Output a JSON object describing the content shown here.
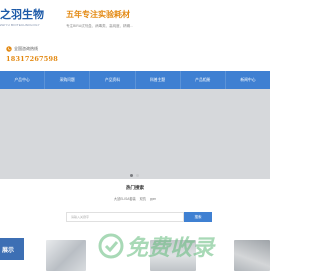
{
  "header": {
    "logo_text": "之羽生物",
    "logo_sub": "ZHIYU BIOTECHNOLOGY",
    "slogan": "五年专注实验耗材",
    "subslogan": "专注BIRA试剂盒、病毒类、高纯度、精确...",
    "hotline_label": "全国咨询热线",
    "hotline_number": "18317267598"
  },
  "nav": {
    "items": [
      "产品中心",
      "采购问题",
      "产品资料",
      "科普主题",
      "产品相册",
      "新闻中心"
    ]
  },
  "banner": {
    "slide_count": 2,
    "active_index": 0
  },
  "search": {
    "title": "热门搜索",
    "hot_terms": [
      "大鼠ELISA套装",
      "双抗",
      "ppm"
    ],
    "placeholder": "请输入关键字",
    "button_label": "搜索"
  },
  "product_tab": "展示",
  "watermark": "免费收录",
  "colors": {
    "primary_blue": "#3f80d2",
    "accent_orange": "#e38912",
    "logo_blue": "#1d5aa8"
  }
}
